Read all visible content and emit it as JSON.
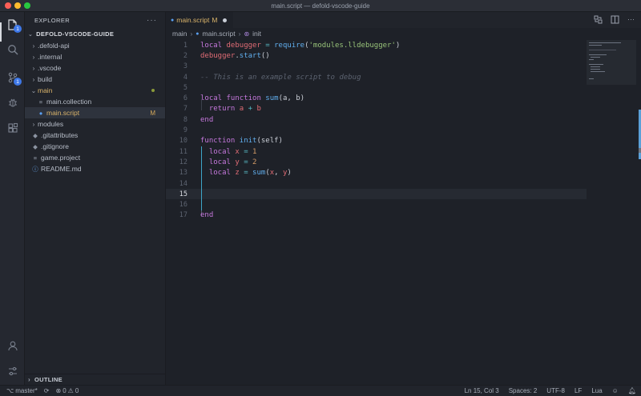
{
  "window": {
    "title": "main.script — defold-vscode-guide"
  },
  "activity_bar": {
    "explorer_badge": "1",
    "scm_badge": "1"
  },
  "sidebar": {
    "header": "EXPLORER",
    "more": "···",
    "root": "DEFOLD-VSCODE-GUIDE",
    "items": [
      {
        "name": ".defold-api",
        "type": "folder",
        "expanded": false
      },
      {
        "name": ".internal",
        "type": "folder",
        "expanded": false
      },
      {
        "name": ".vscode",
        "type": "folder",
        "expanded": false
      },
      {
        "name": "build",
        "type": "folder",
        "expanded": false
      },
      {
        "name": "main",
        "type": "folder",
        "expanded": true
      },
      {
        "name": "main.collection",
        "type": "file"
      },
      {
        "name": "main.script",
        "type": "lua",
        "git": "M"
      },
      {
        "name": "modules",
        "type": "folder",
        "expanded": false
      },
      {
        "name": ".gitattributes",
        "type": "file"
      },
      {
        "name": ".gitignore",
        "type": "file"
      },
      {
        "name": "game.project",
        "type": "file"
      },
      {
        "name": "README.md",
        "type": "info"
      }
    ],
    "outline": "OUTLINE"
  },
  "editor": {
    "tab": {
      "name": "main.script",
      "git": "M"
    },
    "breadcrumb": [
      "main",
      "main.script",
      "init"
    ],
    "current_line": 15,
    "line_numbers": [
      "1",
      "2",
      "3",
      "4",
      "5",
      "6",
      "7",
      "8",
      "9",
      "10",
      "11",
      "12",
      "13",
      "14",
      "15",
      "16",
      "17"
    ]
  },
  "status": {
    "branch": "master*",
    "errors": "0",
    "warnings": "0",
    "position": "Ln 15, Col 3",
    "spaces": "Spaces: 2",
    "encoding": "UTF-8",
    "eol": "LF",
    "language": "Lua"
  },
  "colors": {
    "keyword": "#c678dd",
    "string": "#98c379",
    "variable": "#e06c75",
    "function": "#61afef",
    "comment": "#5c6370",
    "accent": "#3e78e8"
  }
}
